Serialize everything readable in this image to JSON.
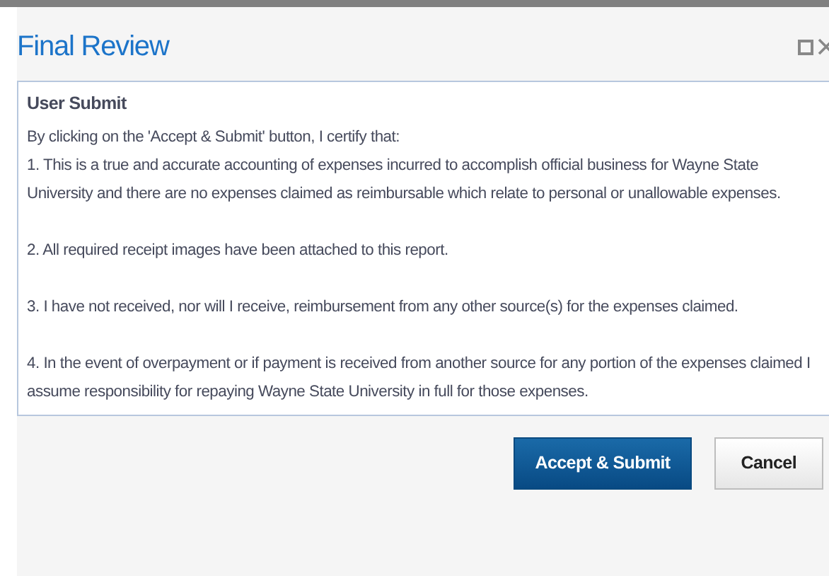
{
  "dialog": {
    "title": "Final Review"
  },
  "content": {
    "heading": "User Submit",
    "paragraphs": [
      "By clicking on the 'Accept & Submit' button, I certify that:",
      "1. This is a true and accurate accounting of expenses incurred to accomplish official business for Wayne State University and there are no expenses claimed as reimbursable which relate to personal or unallowable expenses.",
      "2. All required receipt images have been attached to this report.",
      "3. I have not received, nor will I receive, reimbursement from any other source(s) for the expenses claimed.",
      "4. In the event of overpayment or if payment is received from another source for any portion of the expenses claimed I assume responsibility for repaying Wayne State University in full for those expenses."
    ]
  },
  "buttons": [
    {
      "label": "Accept & Submit",
      "kind": "primary"
    },
    {
      "label": "Cancel",
      "kind": "secondary"
    }
  ]
}
